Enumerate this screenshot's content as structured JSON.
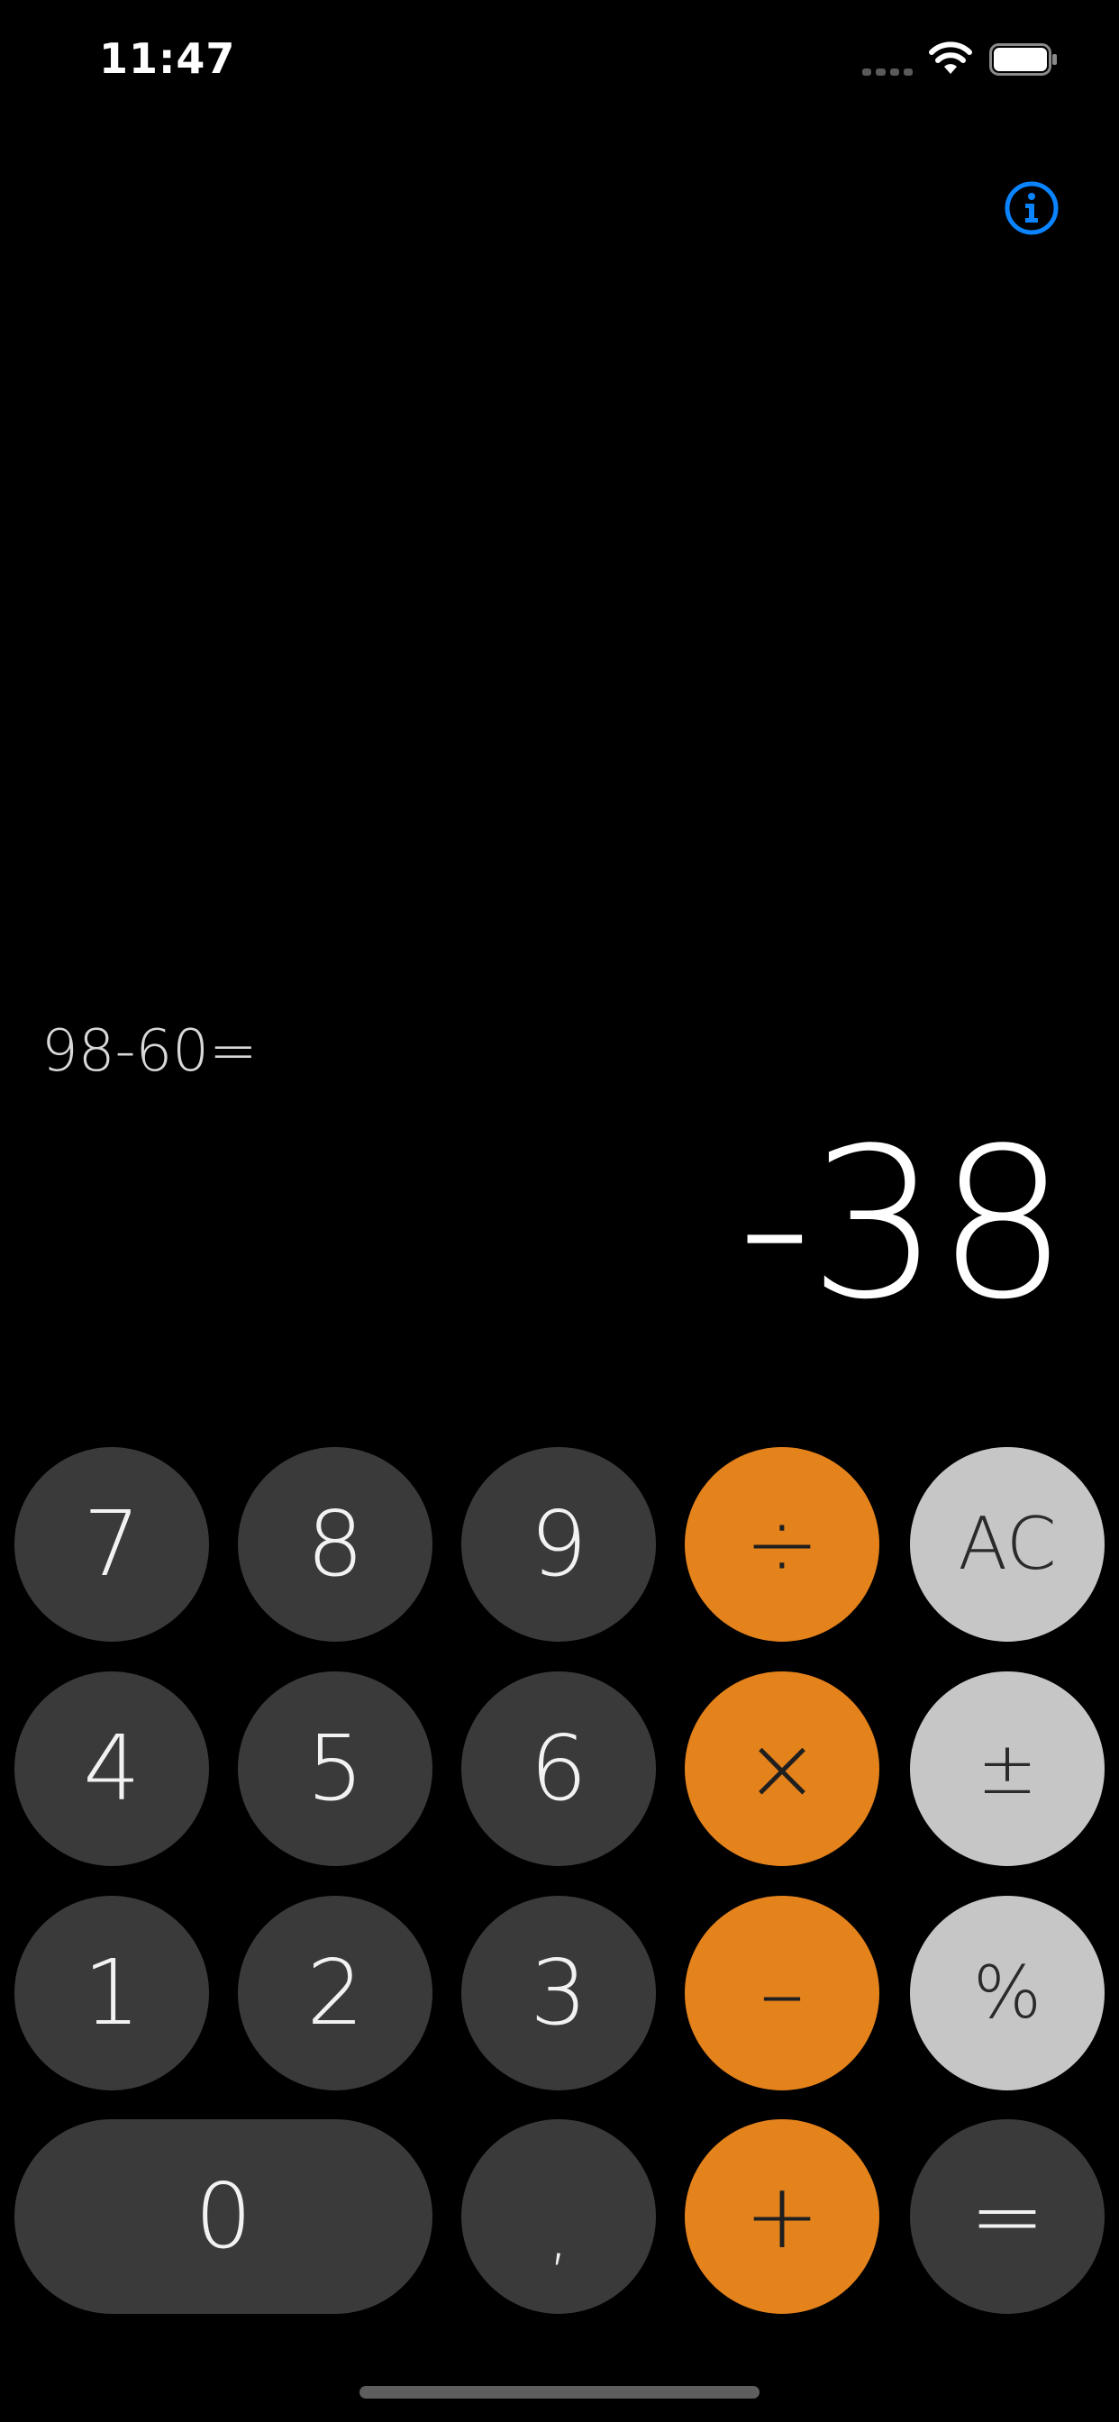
{
  "status_bar": {
    "time": "11:47",
    "icons": [
      "signal-dots-icon",
      "wifi-icon",
      "battery-icon"
    ]
  },
  "info_button": {
    "icon": "info-icon"
  },
  "display": {
    "expression": "98-60=",
    "result": "-38"
  },
  "keypad": {
    "rows": [
      [
        "7",
        "8",
        "9",
        "÷",
        "AC"
      ],
      [
        "4",
        "5",
        "6",
        "×",
        "±"
      ],
      [
        "1",
        "2",
        "3",
        "–",
        "%"
      ],
      [
        "0",
        ",",
        "+",
        "="
      ]
    ]
  },
  "colors": {
    "background": "#000000",
    "digit_key": "#3a3a3a",
    "operator_key": "#e4821c",
    "function_key": "#c6c6c6",
    "info_accent": "#0a84ff"
  }
}
